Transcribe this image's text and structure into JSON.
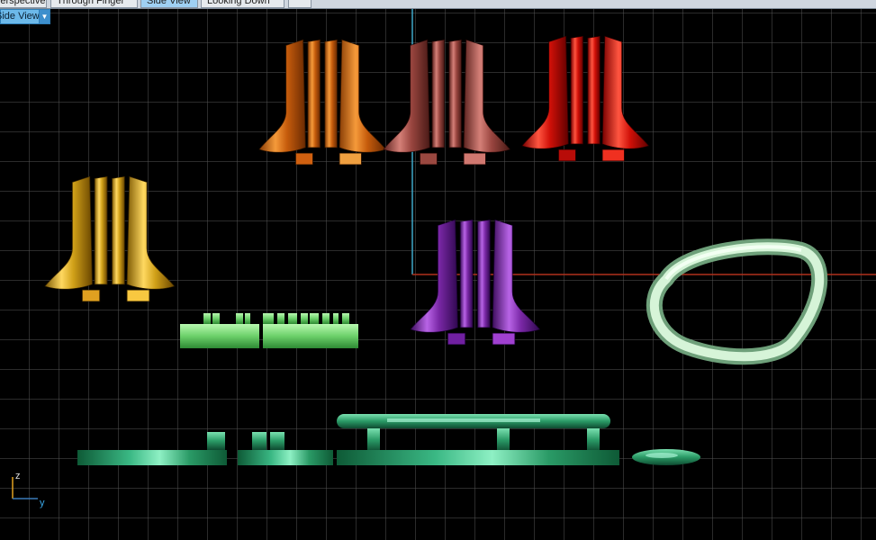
{
  "tabs": [
    {
      "label": "Perspective"
    },
    {
      "label": "Through Finger"
    },
    {
      "label": "Side View",
      "active": true
    },
    {
      "label": "Looking Down"
    },
    {
      "label": ""
    }
  ],
  "view_selector": {
    "label": "Side View",
    "icon": "chevron-down-icon"
  },
  "axes": {
    "vertical": "z",
    "horizontal": "y"
  },
  "objects": [
    {
      "name": "orange-connector",
      "color": "#e07a1a"
    },
    {
      "name": "rose-connector",
      "color": "#b05a54"
    },
    {
      "name": "red-connector",
      "color": "#e01810"
    },
    {
      "name": "gold-connector",
      "color": "#e0b020"
    },
    {
      "name": "purple-connector",
      "color": "#8a2eb8"
    },
    {
      "name": "light-green-plate",
      "color": "#78e078"
    },
    {
      "name": "mint-ring",
      "color": "#c8ecd0"
    },
    {
      "name": "dark-green-rail",
      "color": "#2aa06a"
    }
  ],
  "colors": {
    "grid": "#5a5a5a",
    "viewport_bg": "#000000",
    "x_axis": "#b0301c",
    "z_axis": "#3fa8c8",
    "active_tab": "#9fd0f3"
  }
}
